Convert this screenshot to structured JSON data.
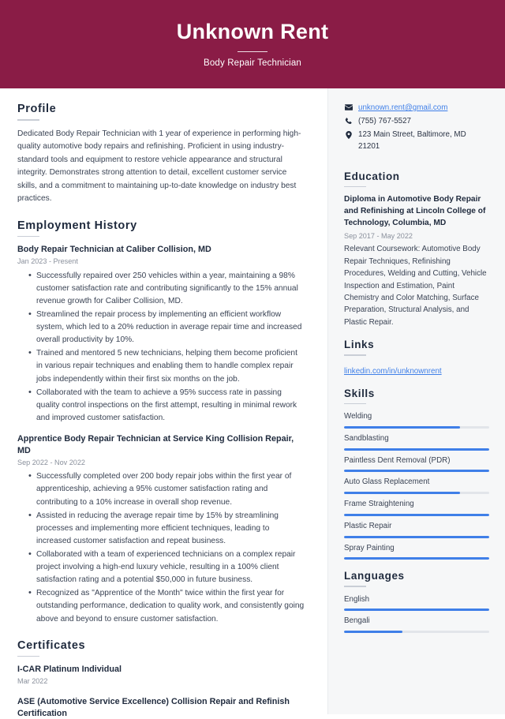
{
  "theme": {
    "header_bg": "#8a1c46",
    "accent_blue": "#3f7fe8",
    "sidebar_bg": "#f6f7f8",
    "text_dark": "#1f2a3d"
  },
  "header": {
    "full_name": "Unknown Rent",
    "job_title": "Body Repair Technician"
  },
  "main": {
    "profile": {
      "heading": "Profile",
      "text": "Dedicated Body Repair Technician with 1 year of experience in performing high-quality automotive body repairs and refinishing. Proficient in using industry-standard tools and equipment to restore vehicle appearance and structural integrity. Demonstrates strong attention to detail, excellent customer service skills, and a commitment to maintaining up-to-date knowledge on industry best practices."
    },
    "employment": {
      "heading": "Employment History",
      "entries": [
        {
          "title": "Body Repair Technician at Caliber Collision, MD",
          "date": "Jan 2023 - Present",
          "bullets": [
            "Successfully repaired over 250 vehicles within a year, maintaining a 98% customer satisfaction rate and contributing significantly to the 15% annual revenue growth for Caliber Collision, MD.",
            "Streamlined the repair process by implementing an efficient workflow system, which led to a 20% reduction in average repair time and increased overall productivity by 10%.",
            "Trained and mentored 5 new technicians, helping them become proficient in various repair techniques and enabling them to handle complex repair jobs independently within their first six months on the job.",
            "Collaborated with the team to achieve a 95% success rate in passing quality control inspections on the first attempt, resulting in minimal rework and improved customer satisfaction."
          ]
        },
        {
          "title": "Apprentice Body Repair Technician at Service King Collision Repair, MD",
          "date": "Sep 2022 - Nov 2022",
          "bullets": [
            "Successfully completed over 200 body repair jobs within the first year of apprenticeship, achieving a 95% customer satisfaction rating and contributing to a 10% increase in overall shop revenue.",
            "Assisted in reducing the average repair time by 15% by streamlining processes and implementing more efficient techniques, leading to increased customer satisfaction and repeat business.",
            "Collaborated with a team of experienced technicians on a complex repair project involving a high-end luxury vehicle, resulting in a 100% client satisfaction rating and a potential $50,000 in future business.",
            "Recognized as \"Apprentice of the Month\" twice within the first year for outstanding performance, dedication to quality work, and consistently going above and beyond to ensure customer satisfaction."
          ]
        }
      ]
    },
    "certificates": {
      "heading": "Certificates",
      "entries": [
        {
          "title": "I-CAR Platinum Individual",
          "date": "Mar 2022"
        },
        {
          "title": "ASE (Automotive Service Excellence) Collision Repair and Refinish Certification",
          "date": ""
        }
      ]
    }
  },
  "sidebar": {
    "contact": {
      "email": "unknown.rent@gmail.com",
      "phone": "(755) 767-5527",
      "address": "123 Main Street, Baltimore, MD 21201"
    },
    "education": {
      "heading": "Education",
      "entry_title": "Diploma in Automotive Body Repair and Refinishing at Lincoln College of Technology, Columbia, MD",
      "entry_date": "Sep 2017 - May 2022",
      "entry_description": "Relevant Coursework: Automotive Body Repair Techniques, Refinishing Procedures, Welding and Cutting, Vehicle Inspection and Estimation, Paint Chemistry and Color Matching, Surface Preparation, Structural Analysis, and Plastic Repair."
    },
    "links": {
      "heading": "Links",
      "items": [
        {
          "label": "linkedin.com/in/unknownrent"
        }
      ]
    },
    "skills": {
      "heading": "Skills",
      "items": [
        {
          "label": "Welding",
          "level": 80
        },
        {
          "label": "Sandblasting",
          "level": 100
        },
        {
          "label": "Paintless Dent Removal (PDR)",
          "level": 100
        },
        {
          "label": "Auto Glass Replacement",
          "level": 80
        },
        {
          "label": "Frame Straightening",
          "level": 100
        },
        {
          "label": "Plastic Repair",
          "level": 100
        },
        {
          "label": "Spray Painting",
          "level": 100
        }
      ]
    },
    "languages": {
      "heading": "Languages",
      "items": [
        {
          "label": "English",
          "level": 100
        },
        {
          "label": "Bengali",
          "level": 40
        }
      ]
    }
  }
}
